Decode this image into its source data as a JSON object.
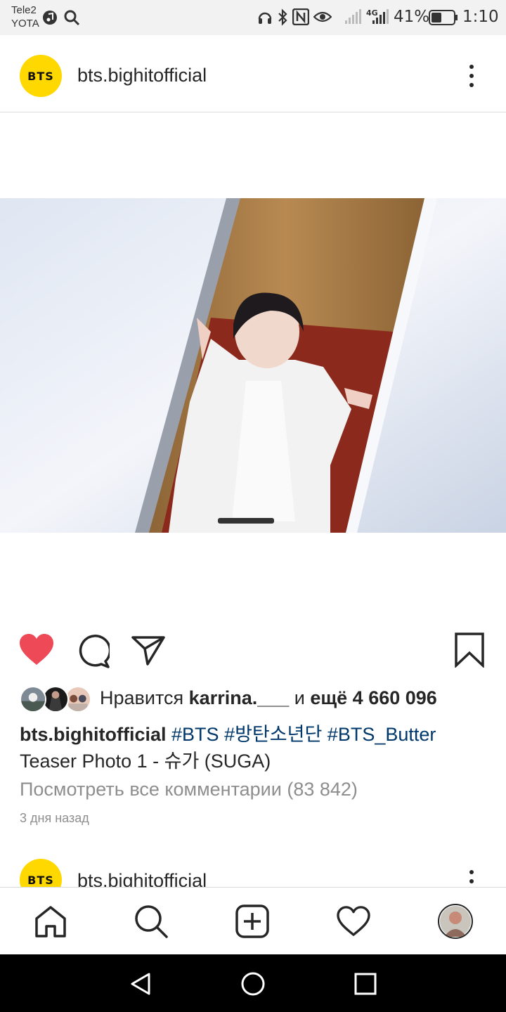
{
  "status_bar": {
    "carrier_1": "Tele2",
    "carrier_2": "YOTA",
    "network": "4G",
    "battery": "41%",
    "time": "1:10"
  },
  "post": {
    "avatar_text": "BTS",
    "username": "bts.bighitofficial",
    "likes": {
      "prefix": "Нравится ",
      "user": "karrina.___",
      "middle": " и ",
      "more": "ещё 4 660 096"
    },
    "caption": {
      "user": "bts.bighitofficial",
      "tags": [
        "#BTS",
        "#방탄소년단",
        "#BTS_Butter"
      ],
      "text": "Teaser Photo 1 - 슈가 (SUGA)"
    },
    "comments_link": "Посмотреть все комментарии (83 842)",
    "time": "3 дня назад"
  },
  "next_post": {
    "avatar_text": "BTS",
    "username": "bts.bighitofficial"
  },
  "colors": {
    "like_red": "#ed4956",
    "avatar_yellow": "#ffd800",
    "hashtag": "#00376b",
    "muted": "#8e8e8e"
  },
  "icons": {
    "nav": [
      "home-icon",
      "search-icon",
      "add-post-icon",
      "activity-heart-icon",
      "profile-avatar"
    ],
    "actions": [
      "liked-heart-icon",
      "comment-icon",
      "share-icon",
      "bookmark-icon"
    ]
  }
}
